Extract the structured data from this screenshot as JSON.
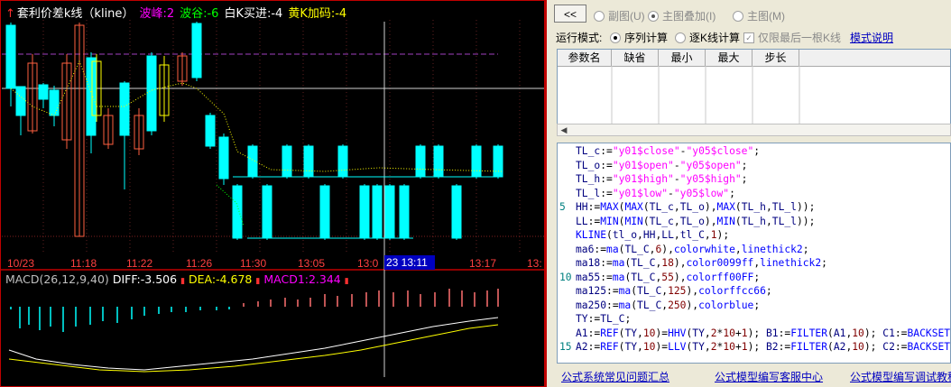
{
  "chart": {
    "title_arrow": "↑",
    "title": "套利价差k线（kline）",
    "peak_label": "波峰:2",
    "trough_label": "波谷:-6",
    "white_k_label": "白K买进:-4",
    "yellow_k_label": "黄K加码:-4",
    "time_ticks": [
      "10/23",
      "11:18",
      "11:22",
      "11:26",
      "11:30",
      "13:05",
      "13:0",
      "13:13",
      "13:17",
      "13:"
    ],
    "cursor_time": "23 13:11",
    "macd_label": "MACD(26,12,9,40)",
    "diff_label": "DIFF:-3.506",
    "dea_label": "DEA:-4.678",
    "macd_value_label": "MACD1:2.344",
    "colors": {
      "cyan": "#00ffff",
      "salmon": "#ff6040",
      "yellow": "#ffff00",
      "magenta": "#ff00ff",
      "green": "#00ff00",
      "white": "#ffffff",
      "red": "#ff3030"
    }
  },
  "editor": {
    "back_button": "<<",
    "view_modes": [
      {
        "label": "副图",
        "key": "(U)",
        "selected": false
      },
      {
        "label": "主图叠加",
        "key": "(I)",
        "selected": true
      },
      {
        "label": "主图",
        "key": "(M)",
        "selected": false
      }
    ],
    "run_mode_label": "运行模式:",
    "run_modes": [
      {
        "label": "序列计算",
        "selected": true
      },
      {
        "label": "逐K线计算",
        "selected": false
      }
    ],
    "last_bar_only": "仅限最后一根K线",
    "mode_help": "模式说明",
    "param_columns": [
      "参数名",
      "缺省",
      "最小",
      "最大",
      "步长"
    ],
    "code_lines": [
      {
        "n": "",
        "t": "TL_c:=\"y01$close\"-\"y05$close\";"
      },
      {
        "n": "",
        "t": "TL_o:=\"y01$open\"-\"y05$open\";"
      },
      {
        "n": "",
        "t": "TL_h:=\"y01$high\"-\"y05$high\";"
      },
      {
        "n": "",
        "t": "TL_l:=\"y01$low\"-\"y05$low\";"
      },
      {
        "n": "5",
        "t": "HH:=MAX(MAX(TL_c,TL_o),MAX(TL_h,TL_l));"
      },
      {
        "n": "",
        "t": "LL:=MIN(MIN(TL_c,TL_o),MIN(TL_h,TL_l));"
      },
      {
        "n": "",
        "t": "KLINE(tl_o,HH,LL,tl_C,1);"
      },
      {
        "n": "",
        "t": "ma6:=ma(TL_C,6),colorwhite,linethick2;"
      },
      {
        "n": "",
        "t": "ma18:=ma(TL_C,18),color0099ff,linethick2;"
      },
      {
        "n": "10",
        "t": "ma55:=ma(TL_C,55),colorff00FF;"
      },
      {
        "n": "",
        "t": "ma125:=ma(TL_C,125),colorffcc66;"
      },
      {
        "n": "",
        "t": "ma250:=ma(TL_C,250),colorblue;"
      },
      {
        "n": "",
        "t": "TY:=TL_C;"
      },
      {
        "n": "",
        "t": "A1:=REF(TY,10)=HHV(TY,2*10+1); B1:=FILTER(A1,10); C1:=BACKSET"
      },
      {
        "n": "15",
        "t": "A2:=REF(TY,10)=LLV(TY,2*10+1); B2:=FILTER(A2,10); C2:=BACKSET"
      }
    ],
    "footer_links": [
      "公式系统常见问题汇总",
      "公式模型编写客服中心",
      "公式模型编写调试教程"
    ]
  }
}
